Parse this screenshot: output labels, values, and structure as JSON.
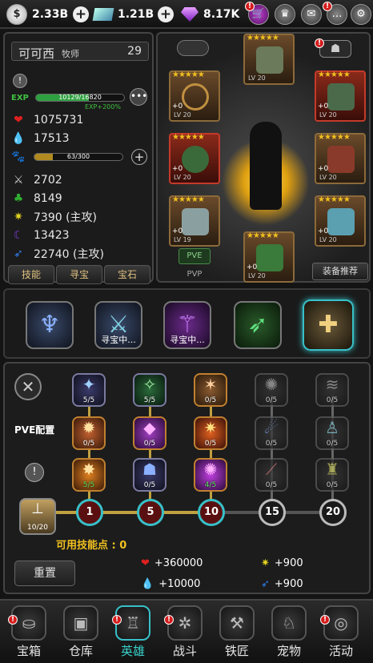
{
  "top": {
    "gold": "2.33B",
    "crystal": "1.21B",
    "gem": "8.17K"
  },
  "hero": {
    "name": "可可西",
    "class": "牧师",
    "level": "29",
    "exp_label": "EXP",
    "exp_text": "10129/16820",
    "exp_bonus": "EXP+200%",
    "exp_fraction": 0.6,
    "pet_text": "63/300",
    "pet_fraction": 0.21,
    "hp": "1075731",
    "mp": "17513",
    "atk": "2702",
    "def": "8149",
    "light": "7390 (主攻)",
    "dark": "13423",
    "magic": "22740 (主攻)"
  },
  "left_buttons": [
    "技能",
    "寻宝",
    "宝石"
  ],
  "equipment": {
    "pve_label": "PVE",
    "pvp_label": "PVP",
    "recommend_label": "装备推荐",
    "slots": [
      {
        "plus": "",
        "lv": "LV 20"
      },
      {
        "plus": "+0",
        "lv": "LV 20"
      },
      {
        "plus": "+0",
        "lv": "LV 20"
      },
      {
        "plus": "+0",
        "lv": "LV 20"
      },
      {
        "plus": "+0",
        "lv": "LV 20"
      },
      {
        "plus": "+0",
        "lv": "LV 19"
      },
      {
        "plus": "+0",
        "lv": "LV 20"
      },
      {
        "plus": "+0",
        "lv": "LV 20"
      },
      {
        "plus": "+0",
        "lv": "LV 20"
      }
    ]
  },
  "classes": [
    {
      "label": ""
    },
    {
      "label": "寻宝中..."
    },
    {
      "label": "寻宝中..."
    },
    {
      "label": ""
    },
    {
      "label": ""
    }
  ],
  "skills": {
    "config_label": "PVE配置",
    "rows": [
      [
        "5/5",
        "5/5",
        "0/5",
        "0/5",
        "0/5"
      ],
      [
        "0/5",
        "0/5",
        "0/5",
        "0/5",
        "0/5"
      ],
      [
        "5/5",
        "0/5",
        "4/5",
        "0/5",
        "0/5"
      ]
    ],
    "progress_text": "10/20",
    "milestones": [
      "1",
      "5",
      "10",
      "15",
      "20"
    ],
    "points_label": "可用技能点 : 0",
    "reset_label": "重置"
  },
  "bonuses": {
    "hp": "+360000",
    "light": "+900",
    "mp": "+10000",
    "magic": "+900"
  },
  "nav": [
    "宝箱",
    "仓库",
    "英雄",
    "战斗",
    "铁匠",
    "宠物",
    "活动"
  ],
  "colors": {
    "accent": "#38c0c8",
    "gold": "#f0c020",
    "alert": "#d41c1c"
  }
}
